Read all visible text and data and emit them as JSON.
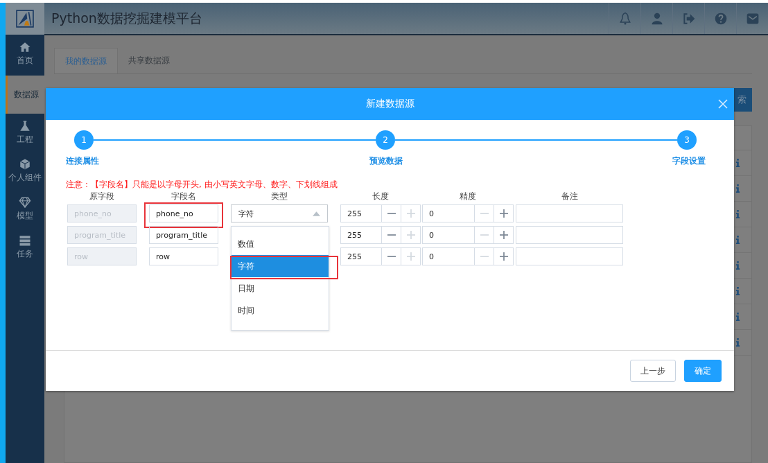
{
  "app": {
    "title": "Python数据挖掘建模平台"
  },
  "sidebar": {
    "items": [
      {
        "label": "首页",
        "selected": false
      },
      {
        "label": "数据源",
        "selected": true
      },
      {
        "label": "工程",
        "selected": false
      },
      {
        "label": "个人组件",
        "selected": false
      },
      {
        "label": "模型",
        "selected": false
      },
      {
        "label": "任务",
        "selected": false
      }
    ]
  },
  "tabs": [
    {
      "label": "我的数据源",
      "selected": true
    },
    {
      "label": "共享数据源",
      "selected": false
    }
  ],
  "search_button": {
    "label": "索"
  },
  "dialog": {
    "title": "新建数据源",
    "steps": [
      {
        "number": "1",
        "label": "连接属性"
      },
      {
        "number": "2",
        "label": "预览数据"
      },
      {
        "number": "3",
        "label": "字段设置"
      }
    ],
    "notice": "注意：【字段名】只能是以字母开头, 由小写英文字母、数字、下划线组成",
    "columns": [
      "原字段",
      "字段名",
      "类型",
      "长度",
      "精度",
      "备注"
    ],
    "rows": [
      {
        "source": "phone_no",
        "name": "phone_no",
        "name_highlighted": true,
        "type": {
          "value": "字符",
          "open": true,
          "options": [
            {
              "label": "数值",
              "selected": false,
              "highlighted": false
            },
            {
              "label": "字符",
              "selected": true,
              "highlighted": true
            },
            {
              "label": "日期",
              "selected": false,
              "highlighted": false
            },
            {
              "label": "时间",
              "selected": false,
              "highlighted": false
            }
          ]
        },
        "length": {
          "value": "255",
          "minus_disabled": false,
          "plus_disabled": true
        },
        "precision": {
          "value": "0",
          "minus_disabled": true,
          "plus_disabled": false
        }
      },
      {
        "source": "program_title",
        "name": "program_title",
        "name_highlighted": false,
        "length": {
          "value": "255",
          "minus_disabled": false,
          "plus_disabled": true
        },
        "precision": {
          "value": "0",
          "minus_disabled": true,
          "plus_disabled": false
        }
      },
      {
        "source": "row",
        "name": "row",
        "name_highlighted": false,
        "length": {
          "value": "255",
          "minus_disabled": false,
          "plus_disabled": true
        },
        "precision": {
          "value": "0",
          "minus_disabled": true,
          "plus_disabled": false
        }
      }
    ],
    "buttons": [
      {
        "label": "上一步",
        "kind": "secondary"
      },
      {
        "label": "确定",
        "kind": "primary"
      }
    ]
  }
}
